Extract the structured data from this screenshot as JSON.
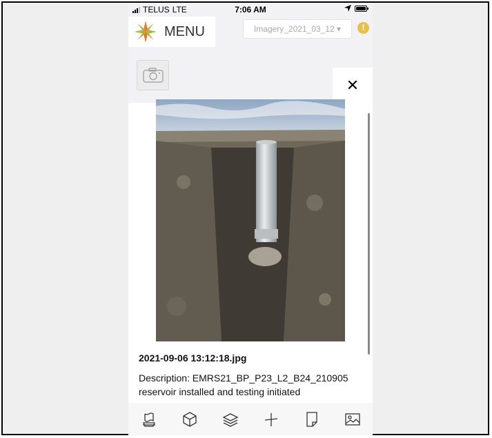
{
  "status_bar": {
    "carrier": "TELUS",
    "network": "LTE",
    "time": "7:06 AM"
  },
  "header": {
    "menu_label": "MENU",
    "imagery_select": "Imagery_2021_03_12 ▾",
    "alert_symbol": "!"
  },
  "camera": {
    "icon": "camera-icon"
  },
  "photo_panel": {
    "close_symbol": "✕",
    "filename": "2021-09-06 13:12:18.jpg",
    "description": "Description: EMRS21_BP_P23_L2_B24_210905 reservoir installed and testing initiated"
  },
  "bottom_toolbar": {
    "items": [
      {
        "icon": "map-view-icon"
      },
      {
        "icon": "3d-box-icon"
      },
      {
        "icon": "layers-icon"
      },
      {
        "icon": "measure-icon"
      },
      {
        "icon": "notes-icon"
      },
      {
        "icon": "image-icon"
      }
    ]
  },
  "colors": {
    "alert": "#e8c04a",
    "logo_orange": "#e07b2a",
    "logo_green": "#9bbf3b"
  }
}
